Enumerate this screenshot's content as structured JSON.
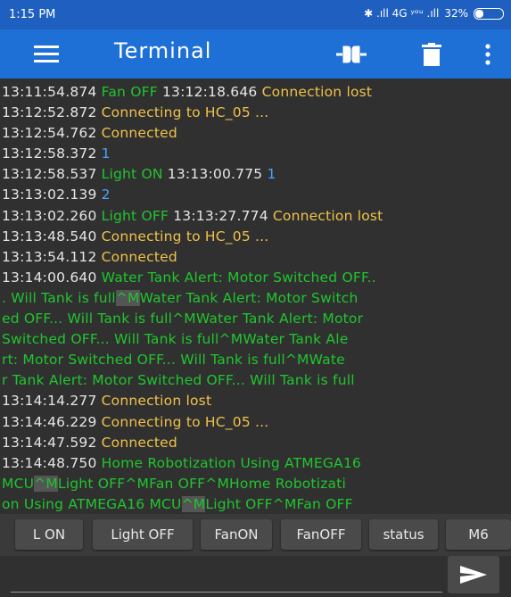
{
  "status_bar": {
    "time": "1:15 PM",
    "indicators": "✱ .ıll 4G ʸᵒᵘ .ıll",
    "battery": "32%"
  },
  "app_bar": {
    "title": "Terminal",
    "icons": [
      "menu-icon",
      "connect-icon",
      "trash-icon",
      "more-vert-icon"
    ]
  },
  "colors": {
    "timestamp": "#e6e6e6",
    "status": "#f0c24a",
    "received": "#20c52e",
    "sent": "#4aa3ff",
    "app_bar": "#1e6fd6"
  },
  "terminal": {
    "lines": [
      [
        {
          "t": "13:11:54.874 ",
          "c": "ts"
        },
        {
          "t": "Fan OFF",
          "c": "rx"
        },
        {
          "t": " 13:12:18.646 ",
          "c": "ts"
        },
        {
          "t": "Connection lost",
          "c": "st"
        }
      ],
      [
        {
          "t": "13:12:52.872 ",
          "c": "ts"
        },
        {
          "t": "Connecting to HC_05 ...",
          "c": "st"
        }
      ],
      [
        {
          "t": "13:12:54.762 ",
          "c": "ts"
        },
        {
          "t": "Connected",
          "c": "st"
        }
      ],
      [
        {
          "t": "13:12:58.372 ",
          "c": "ts"
        },
        {
          "t": "1",
          "c": "tx"
        }
      ],
      [
        {
          "t": "13:12:58.537 ",
          "c": "ts"
        },
        {
          "t": "Light ON",
          "c": "rx"
        },
        {
          "t": " 13:13:00.775 ",
          "c": "ts"
        },
        {
          "t": "1",
          "c": "tx"
        }
      ],
      [
        {
          "t": "13:13:02.139 ",
          "c": "ts"
        },
        {
          "t": "2",
          "c": "tx"
        }
      ],
      [
        {
          "t": "13:13:02.260 ",
          "c": "ts"
        },
        {
          "t": "Light OFF",
          "c": "rx"
        },
        {
          "t": " 13:13:27.774 ",
          "c": "ts"
        },
        {
          "t": "Connection lost",
          "c": "st"
        }
      ],
      [
        {
          "t": "13:13:48.540 ",
          "c": "ts"
        },
        {
          "t": "Connecting to HC_05 ...",
          "c": "st"
        }
      ],
      [
        {
          "t": "13:13:54.112 ",
          "c": "ts"
        },
        {
          "t": "Connected",
          "c": "st"
        }
      ],
      [
        {
          "t": "13:14:00.640 ",
          "c": "ts"
        },
        {
          "t": "Water Tank Alert: Motor Switched OFF..",
          "c": "rx"
        }
      ],
      [
        {
          "t": ". Will Tank is full",
          "c": "rx"
        },
        {
          "t": "^M",
          "c": "ctl"
        },
        {
          "t": "Water Tank Alert: Motor Switch",
          "c": "rx"
        }
      ],
      [
        {
          "t": "ed OFF... Will Tank is full^MWater Tank Alert: Motor",
          "c": "rx"
        }
      ],
      [
        {
          "t": " Switched OFF... Will Tank is full^MWater Tank Ale",
          "c": "rx"
        }
      ],
      [
        {
          "t": "rt: Motor Switched OFF... Will Tank is full^MWate",
          "c": "rx"
        }
      ],
      [
        {
          "t": "r Tank Alert: Motor Switched OFF... Will Tank is full",
          "c": "rx"
        }
      ],
      [
        {
          "t": "13:14:14.277 ",
          "c": "ts"
        },
        {
          "t": "Connection lost",
          "c": "st"
        }
      ],
      [
        {
          "t": "13:14:46.229 ",
          "c": "ts"
        },
        {
          "t": "Connecting to HC_05 ...",
          "c": "st"
        }
      ],
      [
        {
          "t": "13:14:47.592 ",
          "c": "ts"
        },
        {
          "t": "Connected",
          "c": "st"
        }
      ],
      [
        {
          "t": "13:14:48.750 ",
          "c": "ts"
        },
        {
          "t": "Home Robotization Using ATMEGA16",
          "c": "rx"
        }
      ],
      [
        {
          "t": "MCU",
          "c": "rx"
        },
        {
          "t": "^M",
          "c": "ctl"
        },
        {
          "t": "Light OFF^MFan OFF^MHome Robotizati",
          "c": "rx"
        }
      ],
      [
        {
          "t": "on Using ATMEGA16 MCU",
          "c": "rx"
        },
        {
          "t": "^M",
          "c": "ctl"
        },
        {
          "t": "Light OFF^MFan OFF",
          "c": "rx"
        }
      ]
    ]
  },
  "macro_buttons": [
    {
      "label": "L ON",
      "name": "macro-button-l-on"
    },
    {
      "label": "Light OFF",
      "name": "macro-button-light-off"
    },
    {
      "label": "FanON",
      "name": "macro-button-fan-on"
    },
    {
      "label": "FanOFF",
      "name": "macro-button-fan-off"
    },
    {
      "label": "status",
      "name": "macro-button-status"
    },
    {
      "label": "M6",
      "name": "macro-button-m6"
    }
  ],
  "input": {
    "value": "",
    "placeholder": ""
  }
}
